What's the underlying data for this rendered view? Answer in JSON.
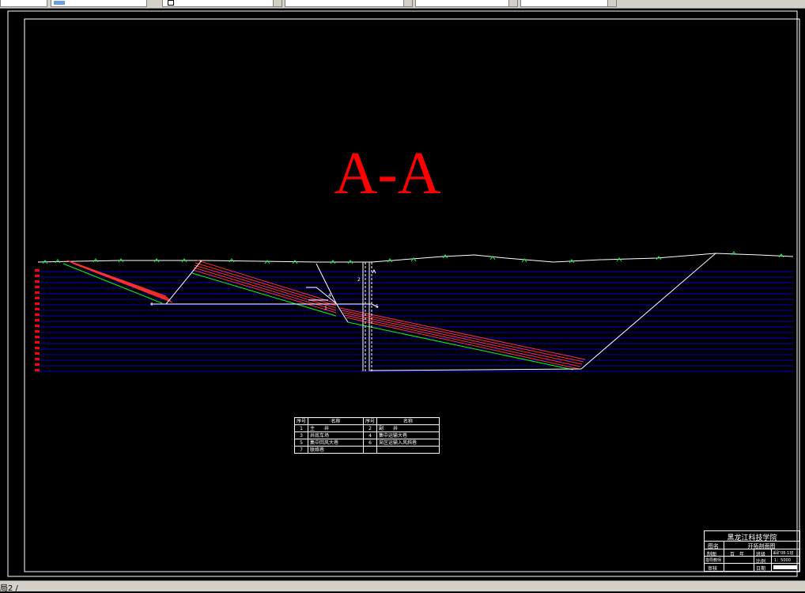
{
  "section_title": "A-A",
  "colors": {
    "background": "#000000",
    "title": "#ff0000",
    "frame": "#ffffff",
    "seam": "#ff3030",
    "seam_floor": "#00ff00",
    "strata": "#0000c8",
    "strata_marker": "#ff0000",
    "surface_grass": "#00ff40"
  },
  "drawing_labels": {
    "label_1": "1",
    "label_2": "2",
    "label_4": "4",
    "label_5": "5"
  },
  "legend": {
    "header": {
      "no": "序号",
      "name": "名称"
    },
    "items": [
      {
        "no": "1",
        "name": "主　　井"
      },
      {
        "no": "2",
        "name": "副　　井"
      },
      {
        "no": "3",
        "name": "井底车场"
      },
      {
        "no": "4",
        "name": "集中运输大巷"
      },
      {
        "no": "5",
        "name": "集中回风大巷"
      },
      {
        "no": "6",
        "name": "采区运输入风斜巷"
      },
      {
        "no": "7",
        "name": "联络巷"
      }
    ]
  },
  "title_block": {
    "school": "黑龙江科技学院",
    "label_drawing": "图名",
    "drawing_name": "开拓剖面图",
    "label_drawn": "制图",
    "drawn_value": "百　年",
    "label_class": "班级",
    "class_value": "采矿08-1班",
    "label_teacher": "指导教师",
    "label_scale": "比例",
    "scale_value": "1：5000",
    "label_review": "审核",
    "label_date": "日期"
  },
  "status_bar": {
    "text": "局2 /"
  }
}
